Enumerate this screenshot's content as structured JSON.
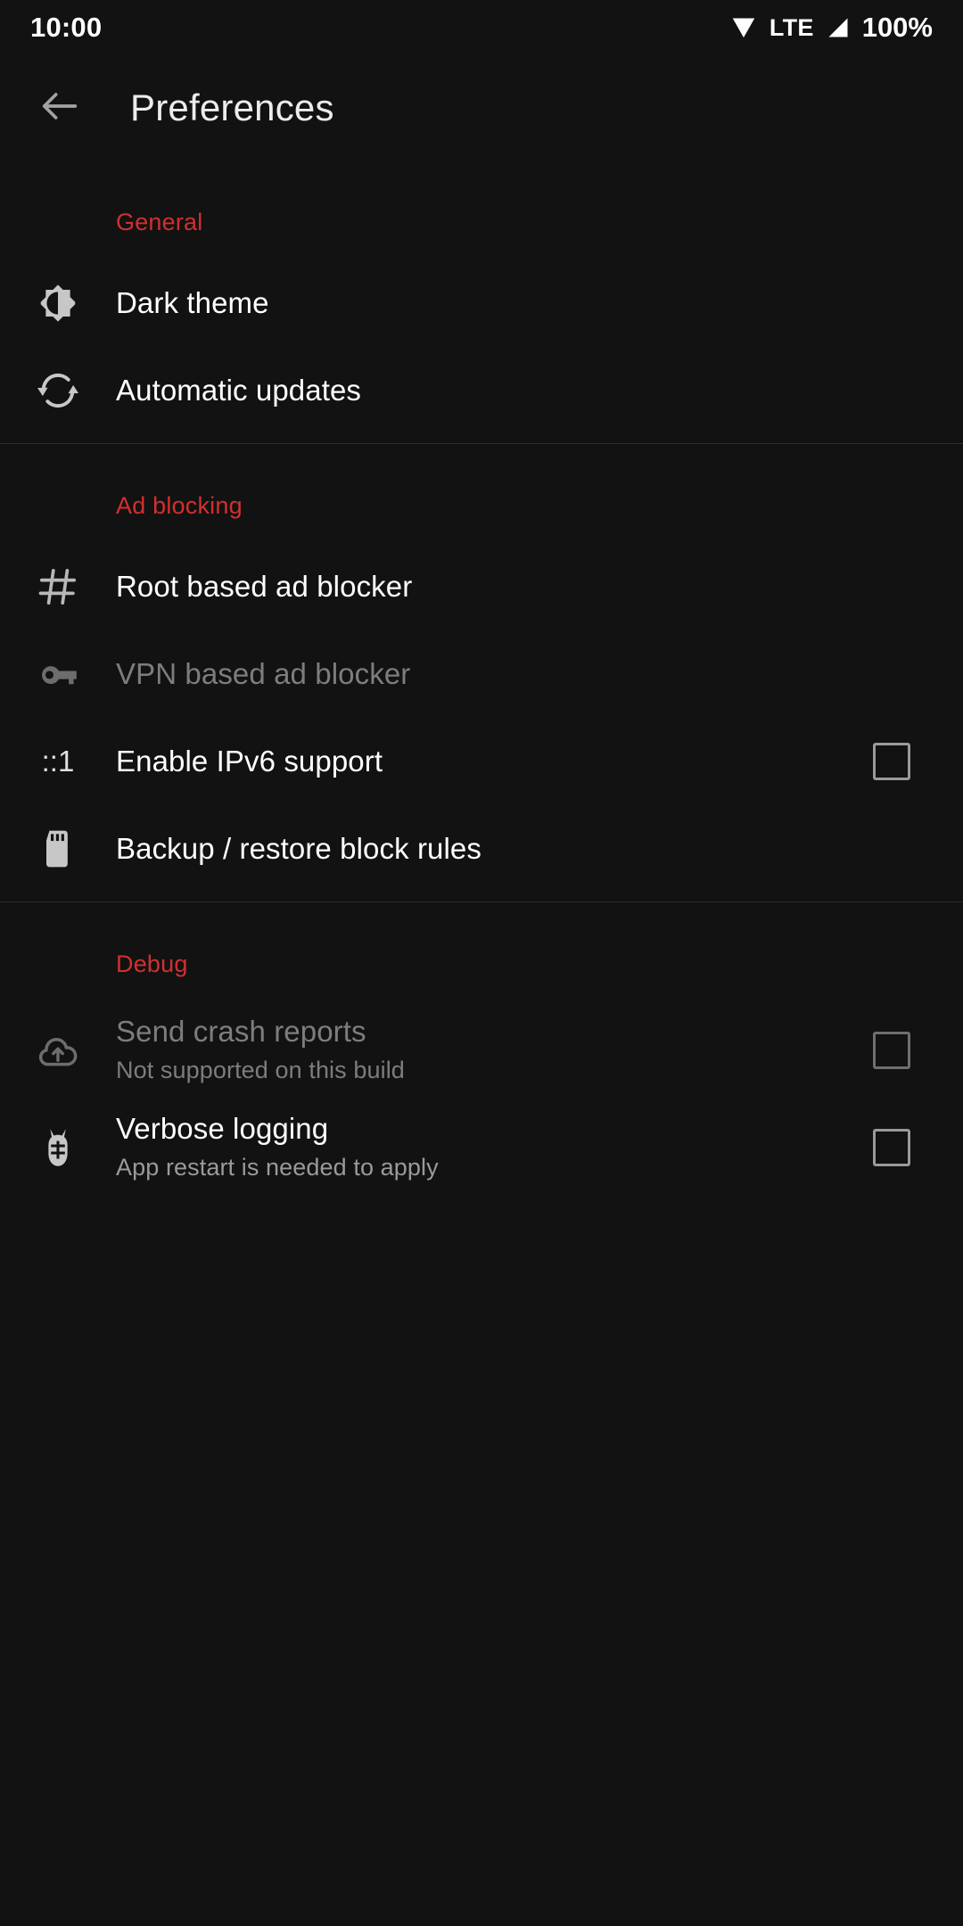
{
  "status_bar": {
    "time": "10:00",
    "network_type": "LTE",
    "battery": "100%",
    "wifi_icon": "wifi-icon",
    "signal_icon": "cell-signal-icon"
  },
  "app_bar": {
    "back_icon": "arrow-back-icon",
    "title": "Preferences"
  },
  "colors": {
    "background": "#121212",
    "accent_red": "#d32f2f",
    "primary_text": "#ffffff",
    "secondary_text": "#9a9a9a",
    "disabled_text": "#7d7d7d",
    "icon": "#c7c7c7",
    "divider": "#2e2e2e"
  },
  "sections": [
    {
      "header": "General",
      "items": [
        {
          "icon": "brightness-contrast-icon",
          "title": "Dark theme",
          "summary": "",
          "widget": "none",
          "enabled": true
        },
        {
          "icon": "sync-icon",
          "title": "Automatic updates",
          "summary": "",
          "widget": "none",
          "enabled": true
        }
      ]
    },
    {
      "header": "Ad blocking",
      "items": [
        {
          "icon": "hash-icon",
          "icon_text": "#",
          "title": "Root based ad blocker",
          "summary": "",
          "widget": "none",
          "enabled": true
        },
        {
          "icon": "vpn-key-icon",
          "title": "VPN based ad blocker",
          "summary": "",
          "widget": "none",
          "enabled": false
        },
        {
          "icon": "ipv6-loopback-icon",
          "icon_text": "::1",
          "title": "Enable IPv6 support",
          "summary": "",
          "widget": "checkbox",
          "checked": false,
          "enabled": true
        },
        {
          "icon": "sd-card-icon",
          "title": "Backup / restore block rules",
          "summary": "",
          "widget": "none",
          "enabled": true
        }
      ]
    },
    {
      "header": "Debug",
      "items": [
        {
          "icon": "cloud-upload-icon",
          "title": "Send crash reports",
          "summary": "Not supported on this build",
          "widget": "checkbox",
          "checked": false,
          "enabled": false
        },
        {
          "icon": "bug-icon",
          "title": "Verbose logging",
          "summary": "App restart is needed to apply",
          "widget": "checkbox",
          "checked": false,
          "enabled": true
        }
      ]
    }
  ]
}
